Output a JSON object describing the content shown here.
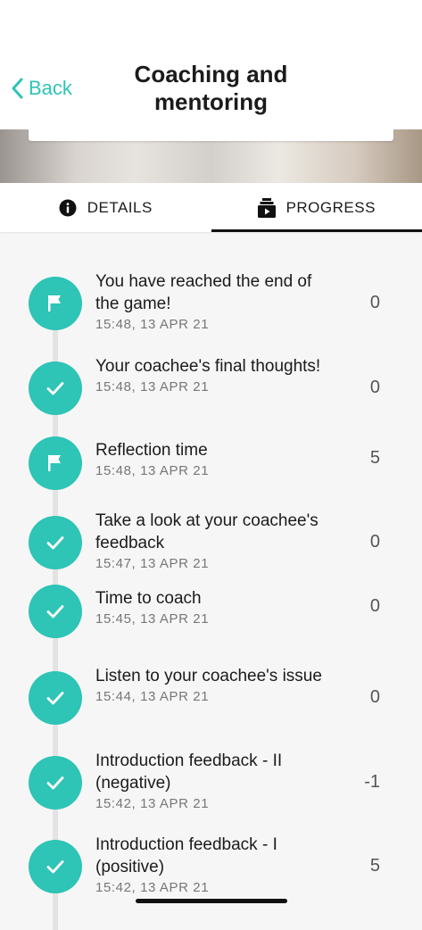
{
  "header": {
    "back_label": "Back",
    "title_line1": "Coaching and",
    "title_line2": "mentoring"
  },
  "colors": {
    "accent": "#2ec4b6",
    "text": "#1b1b1b",
    "muted": "#777777"
  },
  "tabs": [
    {
      "label": "DETAILS",
      "icon": "info-icon",
      "active": false
    },
    {
      "label": "PROGRESS",
      "icon": "progress-icon",
      "active": true
    }
  ],
  "items": [
    {
      "title": "You have reached the end of the game!",
      "time": "15:48, 13 APR 21",
      "score": "0",
      "icon": "flag-icon"
    },
    {
      "title": "Your coachee's final thoughts!",
      "time": "15:48, 13 APR 21",
      "score": "0",
      "icon": "check-icon"
    },
    {
      "title": "Reflection time",
      "time": "15:48, 13 APR 21",
      "score": "5",
      "icon": "flag-icon"
    },
    {
      "title": "Take a look at your coachee's feedback",
      "time": "15:47, 13 APR 21",
      "score": "0",
      "icon": "check-icon"
    },
    {
      "title": "Time to coach",
      "time": "15:45, 13 APR 21",
      "score": "0",
      "icon": "check-icon"
    },
    {
      "title": "Listen to your coachee's issue",
      "time": "15:44, 13 APR 21",
      "score": "0",
      "icon": "check-icon"
    },
    {
      "title": "Introduction feedback - II (negative)",
      "time": "15:42, 13 APR 21",
      "score": "-1",
      "icon": "check-icon"
    },
    {
      "title": "Introduction feedback - I (positive)",
      "time": "15:42, 13 APR 21",
      "score": "5",
      "icon": "check-icon"
    }
  ]
}
